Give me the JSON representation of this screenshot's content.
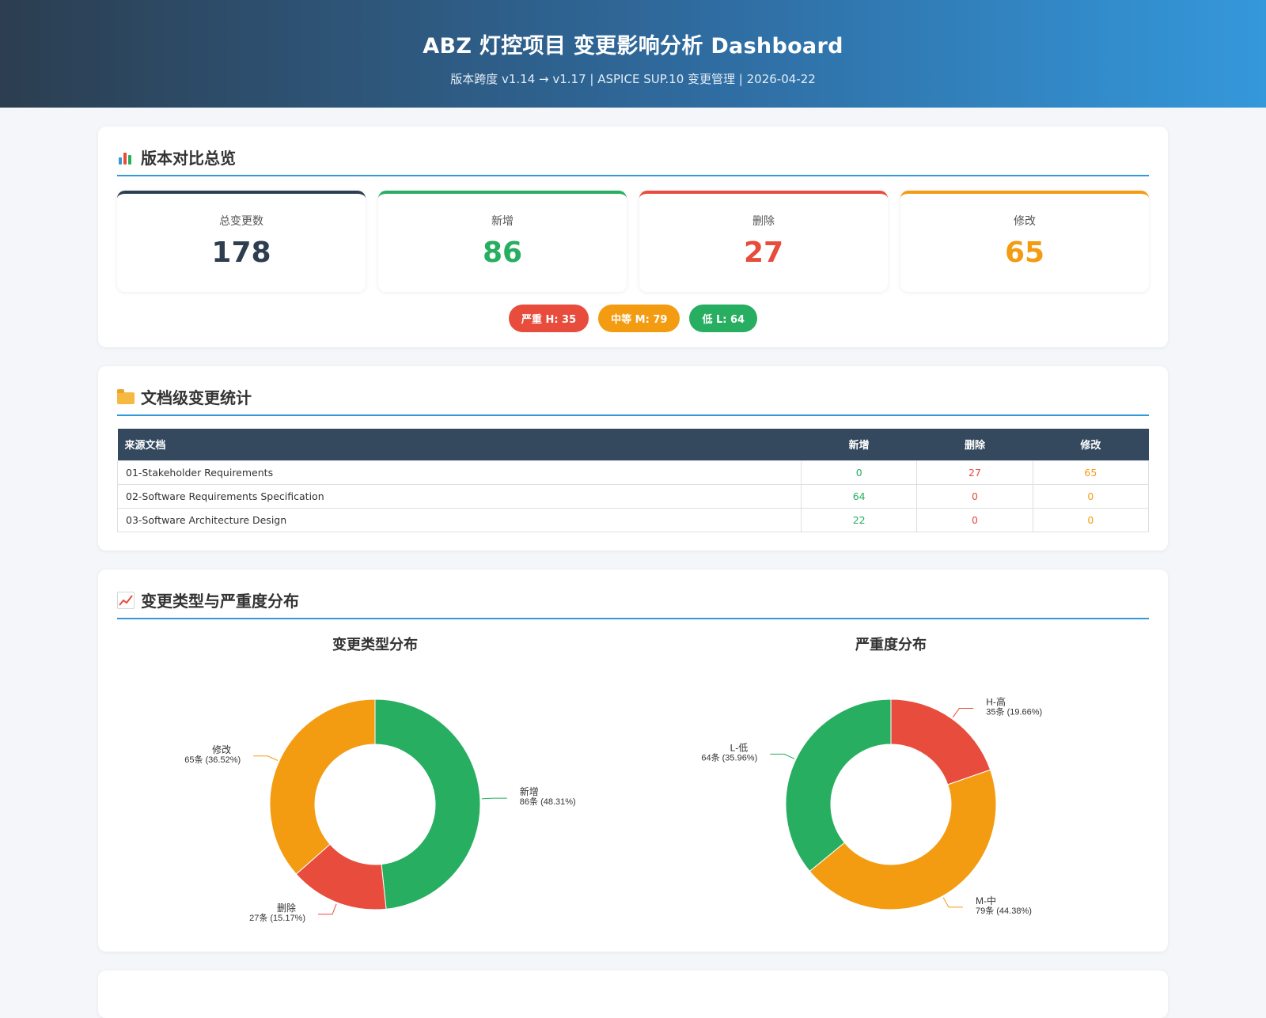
{
  "header": {
    "title": "ABZ 灯控项目 变更影响分析 Dashboard",
    "subtitle": "版本跨度 v1.14 → v1.17 | ASPICE SUP.10 变更管理 | 2026-04-22"
  },
  "overview": {
    "title": "版本对比总览",
    "icon": "bar-chart-icon",
    "stats": [
      {
        "label": "总变更数",
        "value": "178",
        "color": "#2c3e50"
      },
      {
        "label": "新增",
        "value": "86",
        "color": "#27ae60"
      },
      {
        "label": "删除",
        "value": "27",
        "color": "#e74c3c"
      },
      {
        "label": "修改",
        "value": "65",
        "color": "#f39c12"
      }
    ],
    "badges": [
      {
        "label": "严重 H: 35",
        "color": "#e74c3c"
      },
      {
        "label": "中等 M: 79",
        "color": "#f39c12"
      },
      {
        "label": "低 L: 64",
        "color": "#27ae60"
      }
    ]
  },
  "doc_stats": {
    "title": "文档级变更统计",
    "icon": "folder-icon",
    "headers": [
      "来源文档",
      "新增",
      "删除",
      "修改"
    ],
    "rows": [
      {
        "doc": "01-Stakeholder Requirements",
        "add": "0",
        "del": "27",
        "mod": "65"
      },
      {
        "doc": "02-Software Requirements Specification",
        "add": "64",
        "del": "0",
        "mod": "0"
      },
      {
        "doc": "03-Software Architecture Design",
        "add": "22",
        "del": "0",
        "mod": "0"
      }
    ]
  },
  "distribution": {
    "title": "变更类型与严重度分布",
    "icon": "trend-chart-icon"
  },
  "chart_data": [
    {
      "type": "pie",
      "title": "变更类型分布",
      "slices": [
        {
          "name": "新增",
          "value": 86,
          "label": "86条 (48.31%)",
          "color": "#27ae60"
        },
        {
          "name": "删除",
          "value": 27,
          "label": "27条 (15.17%)",
          "color": "#e74c3c"
        },
        {
          "name": "修改",
          "value": 65,
          "label": "65条 (36.52%)",
          "color": "#f39c12"
        }
      ]
    },
    {
      "type": "pie",
      "title": "严重度分布",
      "slices": [
        {
          "name": "H-高",
          "value": 35,
          "label": "35条 (19.66%)",
          "color": "#e74c3c"
        },
        {
          "name": "M-中",
          "value": 79,
          "label": "79条 (44.38%)",
          "color": "#f39c12"
        },
        {
          "name": "L-低",
          "value": 64,
          "label": "64条 (35.96%)",
          "color": "#27ae60"
        }
      ]
    }
  ]
}
